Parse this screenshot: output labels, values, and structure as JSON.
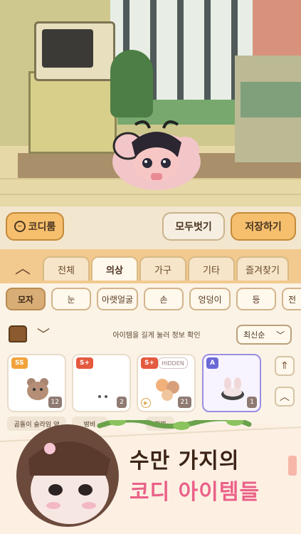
{
  "top_buttons": {
    "codiroom": "코디룸",
    "undress": "모두벗기",
    "save": "저장하기"
  },
  "tabs": [
    {
      "label": "전체",
      "active": false
    },
    {
      "label": "의상",
      "active": true
    },
    {
      "label": "가구",
      "active": false
    },
    {
      "label": "기타",
      "active": false
    },
    {
      "label": "즐겨찾기",
      "active": false
    }
  ],
  "subcategories": [
    {
      "label": "모자",
      "active": true
    },
    {
      "label": "눈",
      "active": false
    },
    {
      "label": "아랫얼굴",
      "active": false
    },
    {
      "label": "손",
      "active": false
    },
    {
      "label": "엉덩이",
      "active": false
    },
    {
      "label": "등",
      "active": false
    },
    {
      "label": "전",
      "active": false
    }
  ],
  "hint": "아이템을 길게 눌러 정보 확인",
  "sort": {
    "selected": "최신순"
  },
  "items": [
    {
      "rank": "SS",
      "count": "12",
      "hidden": "",
      "label": "곰돌이 슬라임 양",
      "rank_color": "#f2a23b"
    },
    {
      "rank": "S+",
      "count": "2",
      "hidden": "",
      "label": "밤비",
      "rank_color": "#e5593e"
    },
    {
      "rank": "S+",
      "count": "21",
      "hidden": "HIDDEN",
      "label": "햄찌",
      "rank_color": "#e5593e"
    },
    {
      "rank": "A",
      "count": "1",
      "hidden": "",
      "label": "",
      "rank_color": "#6b69d6"
    }
  ],
  "promo": {
    "line1": "수만 가지의",
    "line2": "코디 아이템들"
  }
}
